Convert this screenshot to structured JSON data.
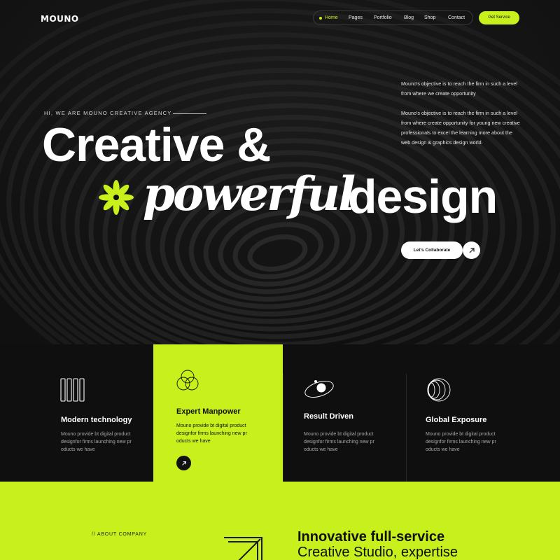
{
  "brand": {
    "logo": "MOUNO",
    "accent": "#c7f01c",
    "background": "#111111"
  },
  "nav": {
    "items": [
      {
        "label": "Home",
        "active": true
      },
      {
        "label": "Pages",
        "active": false
      },
      {
        "label": "Portfolio",
        "active": false
      },
      {
        "label": "Blog",
        "active": false
      },
      {
        "label": "Shop",
        "active": false
      },
      {
        "label": "Contact",
        "active": false
      }
    ],
    "cta": "Get Service"
  },
  "hero": {
    "kicker": "Hi, we are Mouno creative agency",
    "headline_line1": "Creative &",
    "headline_italic": "powerful",
    "headline_word": "design",
    "flower_icon": "asterisk-flower-icon",
    "desc1": "Mouno's objective is to reach the firm in such a level from where we create opportunity",
    "desc2": "Mouno's objective is to reach the firm in such a level from where  create opportunity for young new creative professionals to excel the learning more about the web design & graphics design world.",
    "collab_button": "Let's Collaborate",
    "collab_icon": "arrow-up-right-icon"
  },
  "features": [
    {
      "title": "Modern technology",
      "text": "Mouno provide bt digital product designfor firms launching new pr oducts we have",
      "icon": "bars-icon"
    },
    {
      "title": "Expert Manpower",
      "text": "Mouno provide bt digital product designfor firms launching new pr oducts we have",
      "icon": "venn-circles-icon",
      "highlighted": true
    },
    {
      "title": "Result Driven",
      "text": "Mouno provide bt digital product designfor firms launching new pr oducts we have",
      "icon": "orbit-icon"
    },
    {
      "title": "Global Exposure",
      "text": "Mouno provide bt digital product designfor firms launching new pr oducts we have",
      "icon": "concentric-rings-icon"
    }
  ],
  "about": {
    "kicker": "// ABOUT COMPANY",
    "heading_line1": "Innovative full-service",
    "heading_line2": "Creative Studio, expertise",
    "arrow_icon": "large-arrow-icon"
  }
}
